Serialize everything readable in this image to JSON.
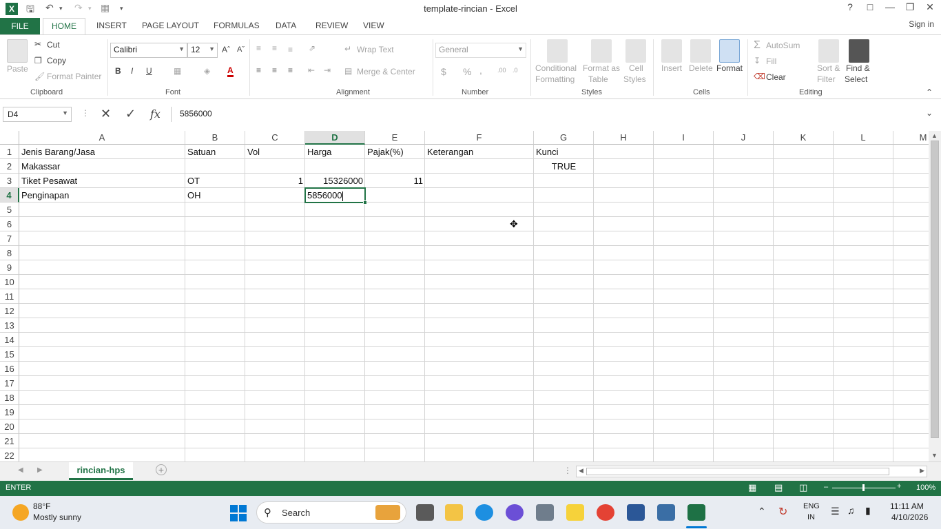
{
  "window": {
    "title": "template-rincian - Excel",
    "logo": "X"
  },
  "qat": {
    "save_icon": "save-icon",
    "undo_icon": "undo-icon",
    "redo_icon": "redo-icon"
  },
  "ribbon_tabs": [
    "FILE",
    "HOME",
    "INSERT",
    "PAGE LAYOUT",
    "FORMULAS",
    "DATA",
    "REVIEW",
    "VIEW"
  ],
  "signin": "Sign in",
  "ribbon": {
    "clipboard": {
      "paste": "Paste",
      "cut": "Cut",
      "copy": "Copy",
      "format_painter": "Format Painter",
      "label": "Clipboard"
    },
    "font": {
      "name": "Calibri",
      "size": "12",
      "bold": "B",
      "italic": "I",
      "underline": "U",
      "label": "Font"
    },
    "alignment": {
      "wrap_text": "Wrap Text",
      "merge_center": "Merge & Center",
      "label": "Alignment"
    },
    "number": {
      "format": "General",
      "currency": "$",
      "percent": "%",
      "comma": ",",
      "label": "Number"
    },
    "styles": {
      "conditional": "Conditional",
      "conditional2": "Formatting",
      "format_as": "Format as",
      "format_as2": "Table",
      "cell": "Cell",
      "cell2": "Styles",
      "label": "Styles"
    },
    "cells": {
      "insert": "Insert",
      "delete": "Delete",
      "format": "Format",
      "label": "Cells"
    },
    "editing": {
      "autosum": "AutoSum",
      "fill": "Fill",
      "clear": "Clear",
      "sort": "Sort &",
      "sort2": "Filter",
      "find": "Find &",
      "find2": "Select",
      "label": "Editing"
    }
  },
  "formula_bar": {
    "name_box": "D4",
    "fx": "fx",
    "content": "5856000"
  },
  "columns": [
    "A",
    "B",
    "C",
    "D",
    "E",
    "F",
    "G",
    "H",
    "I",
    "J",
    "K",
    "L",
    "M"
  ],
  "rows": [
    "1",
    "2",
    "3",
    "4",
    "5",
    "6",
    "7",
    "8",
    "9",
    "10",
    "11",
    "12",
    "13",
    "14",
    "15",
    "16",
    "17",
    "18",
    "19",
    "20",
    "21",
    "22"
  ],
  "cells": {
    "A1": "Jenis Barang/Jasa",
    "B1": "Satuan",
    "C1": "Vol",
    "D1": "Harga",
    "E1": "Pajak(%)",
    "F1": "Keterangan",
    "G1": "Kunci",
    "A2": "Makassar",
    "G2": "TRUE",
    "A3": "Tiket Pesawat",
    "B3": "OT",
    "C3": "1",
    "D3": "15326000",
    "E3": "11",
    "A4": "Penginapan",
    "B4": "OH",
    "D4": "5856000"
  },
  "sheet_tab": "rincian-hps",
  "status": {
    "mode": "ENTER",
    "zoom": "100%"
  },
  "taskbar": {
    "weather_temp": "88°F",
    "weather_desc": "Mostly sunny",
    "search": "Search",
    "lang1": "ENG",
    "lang2": "IN",
    "time": "11:11 AM",
    "date": "4/10/2026"
  }
}
